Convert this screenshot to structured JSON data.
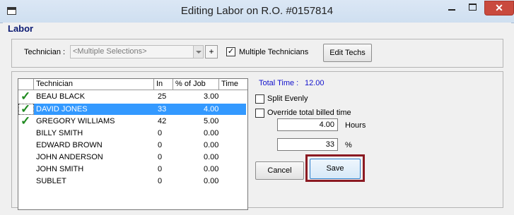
{
  "window": {
    "title": "Editing Labor on R.O. #0157814"
  },
  "section": {
    "label": "Labor"
  },
  "technician": {
    "label": "Technician :",
    "select_value": "<Multiple Selections>",
    "add_button": "+",
    "multiple_label": "Multiple Technicians",
    "multiple_checked": "✓",
    "edit_techs": "Edit Techs"
  },
  "grid": {
    "headers": [
      "Technician",
      "In",
      "% of Job",
      "Time"
    ],
    "rows": [
      {
        "name": "BEAU BLACK",
        "in": "",
        "pct": "25",
        "time": "3.00",
        "check": "✓"
      },
      {
        "name": "DAVID JONES",
        "in": "",
        "pct": "33",
        "time": "4.00",
        "check": "✓"
      },
      {
        "name": "GREGORY WILLIAMS",
        "in": "",
        "pct": "42",
        "time": "5.00",
        "check": "✓"
      },
      {
        "name": "BILLY SMITH",
        "in": "",
        "pct": "0",
        "time": "0.00",
        "check": ""
      },
      {
        "name": "EDWARD BROWN",
        "in": "",
        "pct": "0",
        "time": "0.00",
        "check": ""
      },
      {
        "name": "JOHN ANDERSON",
        "in": "",
        "pct": "0",
        "time": "0.00",
        "check": ""
      },
      {
        "name": "JOHN SMITH",
        "in": "",
        "pct": "0",
        "time": "0.00",
        "check": ""
      },
      {
        "name": "SUBLET",
        "in": "",
        "pct": "0",
        "time": "0.00",
        "check": ""
      }
    ]
  },
  "panel": {
    "total_label": "Total Time :",
    "total_value": "12.00",
    "split_label": "Split Evenly",
    "override_label": "Override total billed time",
    "hours_value": "4.00",
    "hours_label": "Hours",
    "pct_value": "33",
    "pct_label": "%",
    "cancel": "Cancel",
    "save": "Save"
  },
  "colors": {
    "accent": "#0b1a72",
    "selection": "#3399ff",
    "total_text": "#1111cc",
    "highlight": "#8b1a22"
  }
}
